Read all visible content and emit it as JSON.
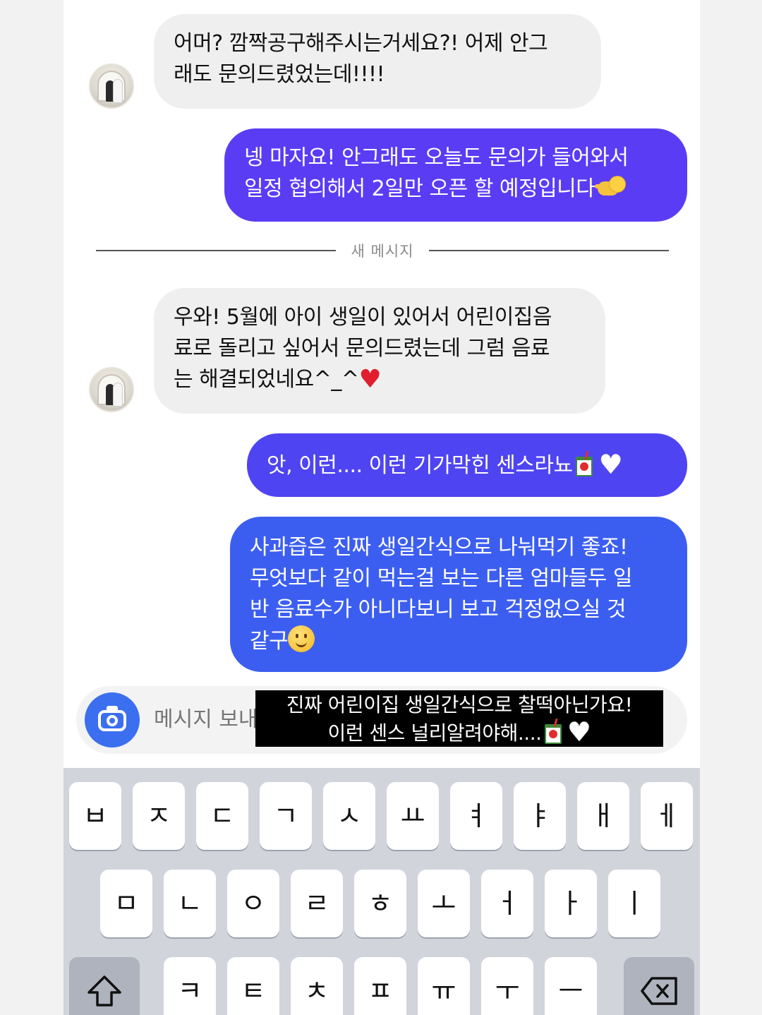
{
  "messages": [
    {
      "direction": "incoming",
      "lines": [
        "어머? 깜짝공구해주시는거세요?! 어제 안그",
        "래도 문의드렸었는데!!!!"
      ]
    },
    {
      "direction": "outgoing",
      "lines": [
        "넹 마자요! 안그래도 오늘도 문의가 들어와서",
        "일정 협의해서 2일만 오픈 할 예정입니다"
      ],
      "emoji": "pointing-left-face-icon"
    },
    {
      "direction": "incoming",
      "lines": [
        "우와! 5월에 아이 생일이 있어서 어린이집음",
        "료로 돌리고 싶어서 문의드렸는데 그럼 음료",
        "는 해결되었네요^_^"
      ],
      "emoji": "red-heart-icon"
    },
    {
      "direction": "outgoing",
      "lines": [
        "앗, 이런.... 이런 기가막힌 센스라뇨"
      ],
      "emoji": [
        "juice-box-icon",
        "white-heart-icon"
      ]
    },
    {
      "direction": "outgoing",
      "lines": [
        "사과즙은 진짜 생일간식으로 나눠먹기 좋죠!",
        "무엇보다 같이 먹는걸 보는 다른 엄마들두 일",
        "반 음료수가 아니다보니 보고 걱정없으실 것",
        "같구"
      ],
      "emoji": "smiling-face-icon"
    }
  ],
  "divider": {
    "label": "새 메시지"
  },
  "composer": {
    "placeholder": "메시지 보내"
  },
  "caption": {
    "line1": "진짜 어린이집 생일간식으로 찰떡아닌가요!",
    "line2": "이런 센스 널리알려야해...."
  },
  "keyboard": {
    "row1": [
      "ㅂ",
      "ㅈ",
      "ㄷ",
      "ㄱ",
      "ㅅ",
      "ㅛ",
      "ㅕ",
      "ㅑ",
      "ㅐ",
      "ㅔ"
    ],
    "row2": [
      "ㅁ",
      "ㄴ",
      "ㅇ",
      "ㄹ",
      "ㅎ",
      "ㅗ",
      "ㅓ",
      "ㅏ",
      "ㅣ"
    ],
    "row3": [
      "ㅋ",
      "ㅌ",
      "ㅊ",
      "ㅍ",
      "ㅠ",
      "ㅜ",
      "ㅡ"
    ],
    "shift_icon": "shift-arrow-icon",
    "backspace_icon": "backspace-icon"
  },
  "colors": {
    "incoming_bubble": "#efefef",
    "outgoing_purple": "#5b3cf5",
    "outgoing_blue": "#3c5ef0",
    "camera_button": "#3b6ff0",
    "keyboard_bg": "#d1d4db"
  }
}
